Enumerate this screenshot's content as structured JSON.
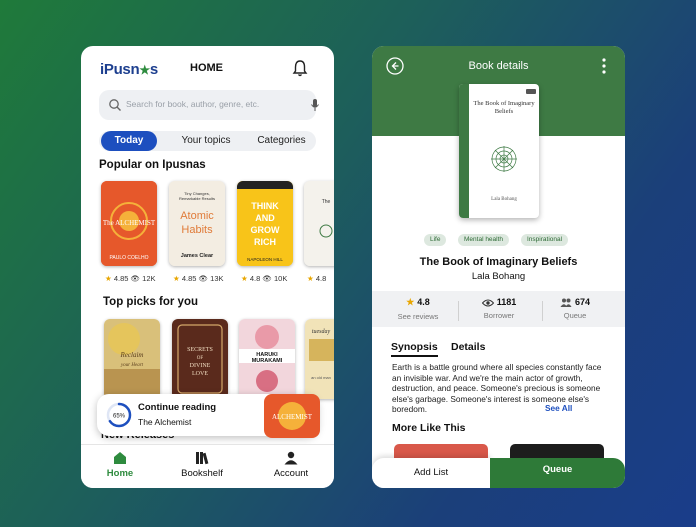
{
  "home": {
    "logo": "iPusn",
    "logo_tail": "s",
    "title": "HOME",
    "search_placeholder": "Search for book, author, genre, etc.",
    "tabs": [
      {
        "label": "Today",
        "active": true
      },
      {
        "label": "Your topics",
        "active": false
      },
      {
        "label": "Categories",
        "active": false
      }
    ],
    "popular_title": "Popular on Ipusnas",
    "popular": [
      {
        "title": "The ALCHEMIST",
        "author": "PAULO COELHO",
        "rating": "4.85",
        "views": "12K"
      },
      {
        "title": "Atomic Habits",
        "author": "James Clear",
        "rating": "4.85",
        "views": "13K"
      },
      {
        "title": "THINK AND GROW RICH",
        "author": "NAPOLEON HILL",
        "rating": "4.8",
        "views": "10K"
      },
      {
        "title": "The",
        "author": "",
        "rating": "4.8",
        "views": ""
      }
    ],
    "top_picks_title": "Top picks for you",
    "top_picks": [
      {
        "title": "Reclaim your Heart"
      },
      {
        "title": "SECRETS OF DIVINE LOVE"
      },
      {
        "title": "HARUKI MURAKAMI"
      },
      {
        "title": "tuesday"
      }
    ],
    "continue_label": "Continue reading",
    "continue_book": "The Alchemist",
    "progress_pct": "65%",
    "progress_value": 0.65,
    "new_releases_title": "New Releases",
    "nav": [
      {
        "label": "Home",
        "active": true
      },
      {
        "label": "Bookshelf",
        "active": false
      },
      {
        "label": "Account",
        "active": false
      }
    ]
  },
  "details": {
    "header_title": "Book details",
    "cover_title": "The Book of Imaginary Beliefs",
    "cover_author": "Lala Bohang",
    "chips": [
      "Life",
      "Mental health",
      "Inspirational"
    ],
    "book_title": "The Book of Imaginary Beliefs",
    "author": "Lala Bohang",
    "stats": [
      {
        "value": "4.8",
        "label": "See reviews",
        "icon": "star-icon"
      },
      {
        "value": "1181",
        "label": "Borrower",
        "icon": "eye-icon"
      },
      {
        "value": "674",
        "label": "Queue",
        "icon": "people-icon"
      }
    ],
    "tabs": [
      {
        "label": "Synopsis",
        "active": true
      },
      {
        "label": "Details",
        "active": false
      }
    ],
    "synopsis": "Earth is a battle ground where all species constantly face an invisible war. And we're the main actor of growth, destruction, and peace. Someone's precious is someone else's garbage. Someone's interest is someone else's boredom.",
    "see_all": "See All",
    "more_title": "More Like This",
    "add_list": "Add List",
    "queue": "Queue"
  }
}
